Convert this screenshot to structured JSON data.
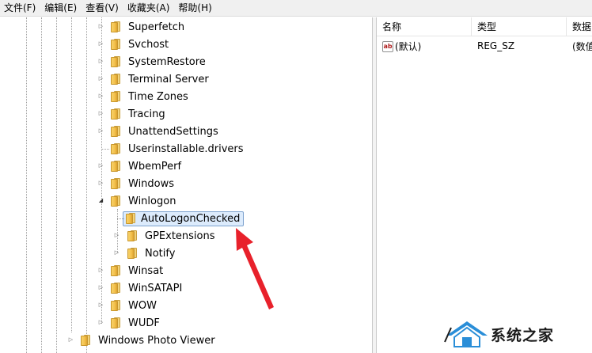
{
  "menu": [
    {
      "label": "文件(F)"
    },
    {
      "label": "编辑(E)"
    },
    {
      "label": "查看(V)"
    },
    {
      "label": "收藏夹(A)"
    },
    {
      "label": "帮助(H)"
    }
  ],
  "tree": {
    "nodes": [
      {
        "label": "Superfetch",
        "expander": "collapsed"
      },
      {
        "label": "Svchost",
        "expander": "collapsed"
      },
      {
        "label": "SystemRestore",
        "expander": "collapsed"
      },
      {
        "label": "Terminal Server",
        "expander": "collapsed"
      },
      {
        "label": "Time Zones",
        "expander": "collapsed"
      },
      {
        "label": "Tracing",
        "expander": "collapsed"
      },
      {
        "label": "UnattendSettings",
        "expander": "collapsed"
      },
      {
        "label": "Userinstallable.drivers",
        "expander": "none"
      },
      {
        "label": "WbemPerf",
        "expander": "collapsed"
      },
      {
        "label": "Windows",
        "expander": "collapsed"
      },
      {
        "label": "Winlogon",
        "expander": "expanded"
      },
      {
        "label": "AutoLogonChecked",
        "expander": "none",
        "selected": true
      },
      {
        "label": "GPExtensions",
        "expander": "collapsed"
      },
      {
        "label": "Notify",
        "expander": "collapsed"
      },
      {
        "label": "Winsat",
        "expander": "collapsed"
      },
      {
        "label": "WinSATAPI",
        "expander": "collapsed"
      },
      {
        "label": "WOW",
        "expander": "collapsed"
      },
      {
        "label": "WUDF",
        "expander": "collapsed"
      },
      {
        "label": "Windows Photo Viewer",
        "expander": "collapsed"
      }
    ]
  },
  "list": {
    "columns": [
      "名称",
      "类型",
      "数据"
    ],
    "rows": [
      {
        "icon": "ab",
        "name": "(默认)",
        "type": "REG_SZ",
        "data": "(数值"
      }
    ]
  },
  "watermark": {
    "text": "系统之家"
  },
  "colors": {
    "selection": "#dcebfc",
    "selection_border": "#7da2ce",
    "arrow": "#e8212b",
    "folder": "#f4c04a"
  }
}
